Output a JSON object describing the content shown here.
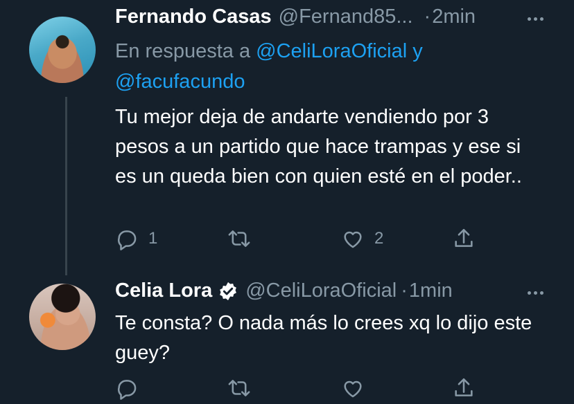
{
  "tweets": [
    {
      "name": "Fernando Casas",
      "handle": "@Fernand85...",
      "separator": "·",
      "time": "2min",
      "reply_prefix": "En respuesta a",
      "reply_mention1": "@CeliLoraOficial",
      "reply_and": "y",
      "reply_mention2": "@facufacundo",
      "text": "Tu mejor deja de andarte vendiendo por 3 pesos a un partido que hace trampas y ese si es un queda bien con quien esté en el poder..",
      "reply_count": "1",
      "retweet_count": "",
      "like_count": "2"
    },
    {
      "name": "Celia Lora",
      "handle": "@CeliLoraOficial",
      "separator": "·",
      "time": "1min",
      "verified": true,
      "text": "Te consta? O nada más lo crees xq lo dijo este guey?",
      "reply_count": "",
      "retweet_count": "",
      "like_count": ""
    }
  ],
  "colors": {
    "background": "#15202b",
    "secondary_text": "#8899a6",
    "link": "#1da1f2",
    "verified_badge": "#ffffff"
  },
  "icons": [
    "reply-icon",
    "retweet-icon",
    "like-icon",
    "share-icon",
    "more-icon",
    "verified-icon"
  ]
}
